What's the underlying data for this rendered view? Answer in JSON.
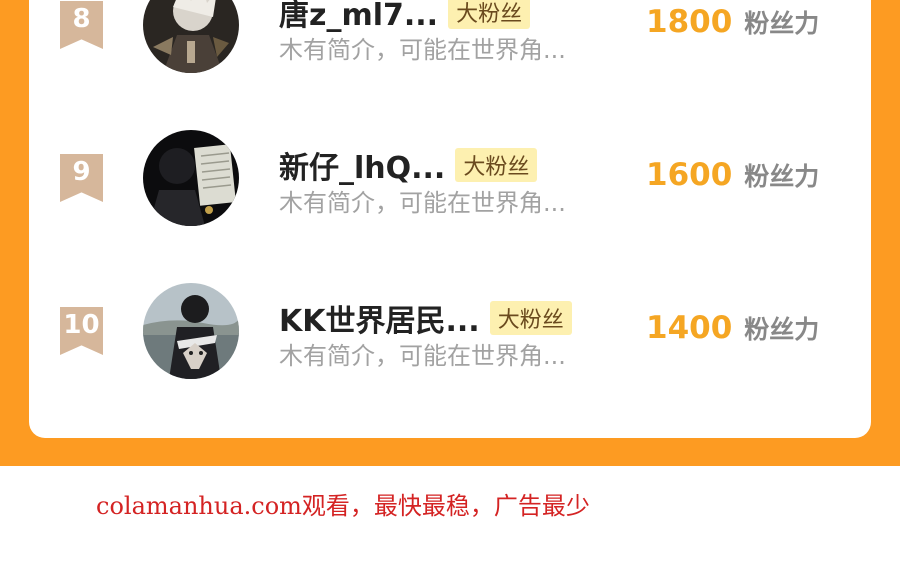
{
  "ranking": [
    {
      "rank": "8",
      "name": "唐z_ml7...",
      "tag": "大粉丝",
      "bio": "木有简介，可能在世界角...",
      "score": "1800",
      "unit": "粉丝力"
    },
    {
      "rank": "9",
      "name": "新仔_lhQ...",
      "tag": "大粉丝",
      "bio": "木有简介，可能在世界角...",
      "score": "1600",
      "unit": "粉丝力"
    },
    {
      "rank": "10",
      "name": "KK世界居民...",
      "tag": "大粉丝",
      "bio": "木有简介，可能在世界角...",
      "score": "1400",
      "unit": "粉丝力"
    }
  ],
  "colors": {
    "panel": "#fd9b22",
    "badge": "#d6b79b",
    "score": "#f5a623",
    "tag_bg": "#fdf0b0",
    "watermark": "#d42323"
  },
  "watermark": "colamanhua.com观看，最快最稳，广告最少"
}
